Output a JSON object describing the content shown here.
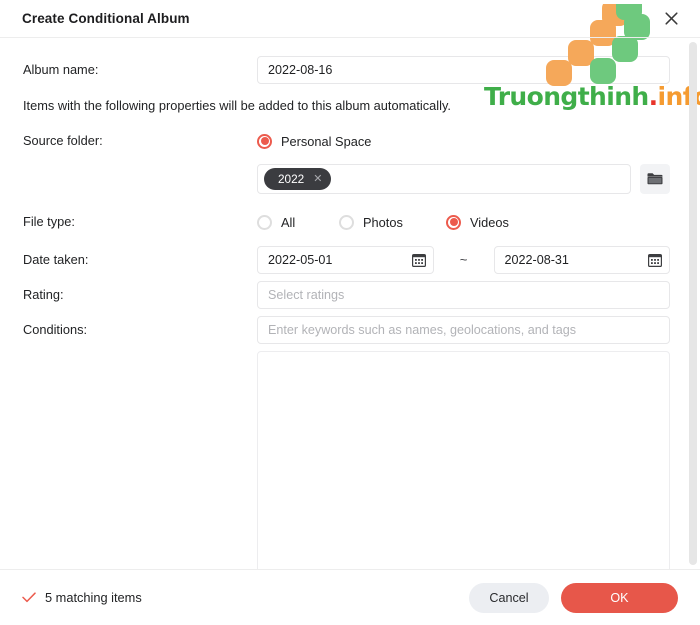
{
  "dialog": {
    "title": "Create Conditional Album",
    "close_icon": "close-icon"
  },
  "form": {
    "album_name": {
      "label": "Album name:",
      "value": "2022-08-16"
    },
    "note": "Items with the following properties will be added to this album automatically.",
    "source_folder": {
      "label": "Source folder:",
      "options": [
        {
          "label": "Personal Space",
          "selected": true
        }
      ],
      "chips": [
        {
          "label": "2022",
          "remove_icon": "close-icon"
        }
      ],
      "browse_icon": "folder-icon"
    },
    "file_type": {
      "label": "File type:",
      "options": [
        {
          "label": "All",
          "selected": false
        },
        {
          "label": "Photos",
          "selected": false
        },
        {
          "label": "Videos",
          "selected": true
        }
      ]
    },
    "date_taken": {
      "label": "Date taken:",
      "start": "2022-05-01",
      "end": "2022-08-31",
      "separator": "~",
      "calendar_icon": "calendar-icon"
    },
    "rating": {
      "label": "Rating:",
      "value": "",
      "placeholder": "Select ratings"
    },
    "conditions": {
      "label": "Conditions:",
      "value": "",
      "placeholder": "Enter keywords such as names, geolocations, and tags"
    },
    "results_panel": {
      "content": ""
    }
  },
  "footer": {
    "match_icon": "check-icon",
    "match_text": "5 matching items",
    "cancel_label": "Cancel",
    "ok_label": "OK"
  },
  "watermark": {
    "text_primary": "Truongthinh",
    "text_dot": ".",
    "text_suffix": "info"
  },
  "colors": {
    "accent": "#ec5b4d",
    "ok_button": "#e7574a",
    "chip": "#3b3c40",
    "watermark_green": "#3fae49",
    "watermark_orange": "#f59b31",
    "watermark_red": "#e8342a"
  }
}
